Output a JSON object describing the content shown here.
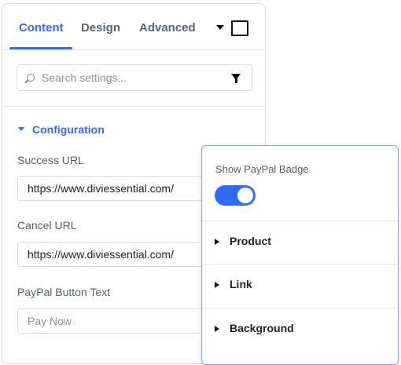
{
  "tabs": [
    {
      "label": "Content",
      "active": true
    },
    {
      "label": "Design",
      "active": false
    },
    {
      "label": "Advanced",
      "active": false
    }
  ],
  "toolbar": {
    "menu_icon": "caret-down-icon",
    "expand_icon": "square-icon"
  },
  "search": {
    "placeholder": "Search settings...",
    "value": ""
  },
  "section": {
    "label": "Configuration",
    "expanded": true
  },
  "fields": {
    "success_url": {
      "label": "Success URL",
      "value": "https://www.diviessential.com/"
    },
    "cancel_url": {
      "label": "Cancel URL",
      "value": "https://www.diviessential.com/"
    },
    "button_text": {
      "label": "PayPal Button Text",
      "value": "",
      "placeholder": "Pay Now"
    }
  },
  "popup": {
    "toggle_label": "Show PayPal Badge",
    "toggle_on": true,
    "rows": [
      {
        "label": "Product"
      },
      {
        "label": "Link"
      },
      {
        "label": "Background"
      }
    ]
  },
  "colors": {
    "accent": "#2f6df6",
    "border": "#d6dbe6",
    "popup_border": "#7ea2f0"
  }
}
